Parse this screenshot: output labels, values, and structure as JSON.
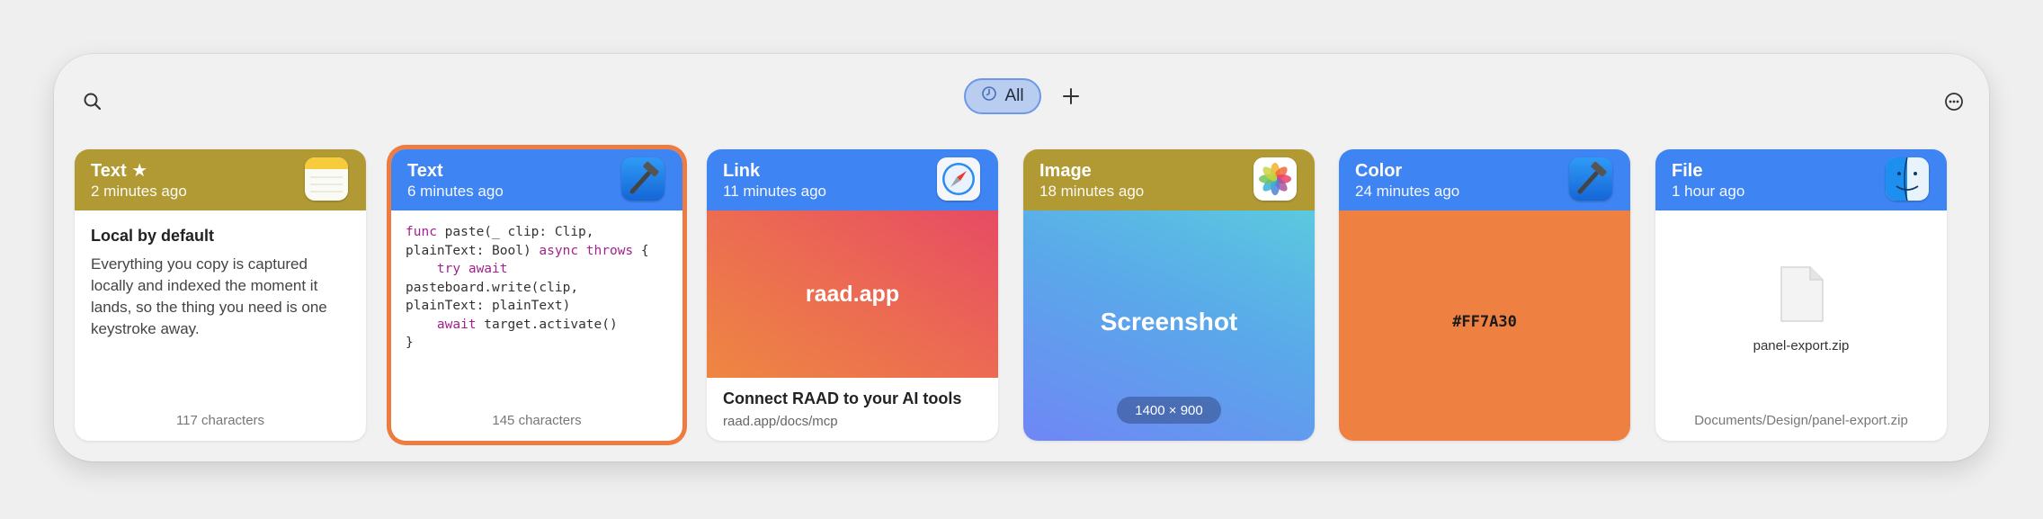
{
  "toolbar": {
    "search_icon": "search-icon",
    "filter_label": "All",
    "filter_icon": "clock-icon",
    "add_label": "+",
    "more_icon": "ellipsis-circle-icon"
  },
  "cards": [
    {
      "kind": "Text ★",
      "time": "2 minutes ago",
      "app_icon": "notes-app-icon",
      "header_color": "#b19a34",
      "heading": "Local by default",
      "body": "Everything you copy is captured locally and indexed the moment it lands, so the thing you need is one keystroke away.",
      "footer": "117 characters"
    },
    {
      "kind": "Text",
      "time": "6 minutes ago",
      "app_icon": "xcode-app-icon",
      "header_color": "#3e84f3",
      "selected": true,
      "footer": "145 characters"
    },
    {
      "kind": "Link",
      "time": "11 minutes ago",
      "app_icon": "safari-app-icon",
      "header_color": "#3e84f3",
      "preview_text": "raad.app",
      "title": "Connect RAAD to your AI tools",
      "url": "raad.app/docs/mcp"
    },
    {
      "kind": "Image",
      "time": "18 minutes ago",
      "app_icon": "photos-app-icon",
      "header_color": "#b19a34",
      "label": "Screenshot",
      "dimensions": "1400 × 900"
    },
    {
      "kind": "Color",
      "time": "24 minutes ago",
      "app_icon": "xcode-app-icon",
      "header_color": "#3e84f3",
      "hex": "#FF7A30",
      "swatch_color": "#ee8142"
    },
    {
      "kind": "File",
      "time": "1 hour ago",
      "app_icon": "finder-app-icon",
      "header_color": "#3e84f3",
      "filename": "panel-export.zip",
      "path": "Documents/Design/panel-export.zip"
    }
  ],
  "code_lines": [
    {
      "parts": [
        {
          "t": "func",
          "kw": true
        },
        {
          "t": " paste(_ clip: Clip,"
        }
      ]
    },
    {
      "parts": [
        {
          "t": "plainText: Bool) "
        },
        {
          "t": "async throws",
          "kw": true
        },
        {
          "t": " {"
        }
      ]
    },
    {
      "parts": [
        {
          "t": "    "
        },
        {
          "t": "try await",
          "kw": true
        }
      ]
    },
    {
      "parts": [
        {
          "t": "pasteboard.write(clip,"
        }
      ]
    },
    {
      "parts": [
        {
          "t": "plainText: plainText)"
        }
      ]
    },
    {
      "parts": [
        {
          "t": "    "
        },
        {
          "t": "await",
          "kw": true
        },
        {
          "t": " target.activate()"
        }
      ]
    },
    {
      "parts": [
        {
          "t": "}"
        }
      ]
    }
  ]
}
